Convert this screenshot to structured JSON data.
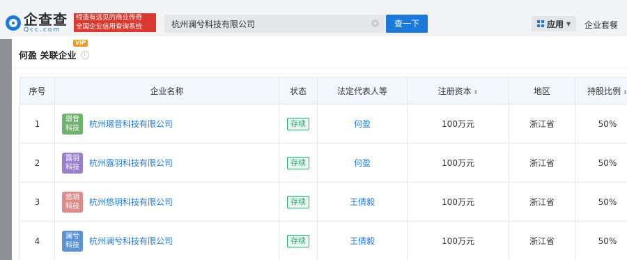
{
  "header": {
    "logo_name": "企查查",
    "logo_domain": "Qcc.com",
    "slogan_line1": "缔造有远见的商业传奇",
    "slogan_line2": "全国企业信用查询系统",
    "search_value": "杭州澜兮科技有限公司",
    "search_button": "查一下",
    "apps_label": "应用",
    "package_label": "企业套餐"
  },
  "modal": {
    "title": "何盈 关联企业",
    "vip_badge": "VIP"
  },
  "table": {
    "columns": [
      "序号",
      "企业名称",
      "状态",
      "法定代表人等",
      "注册资本",
      "地区",
      "持股比例"
    ],
    "sort_icon": "⬍",
    "rows": [
      {
        "no": "1",
        "avatar": [
          "璟昔",
          "科技"
        ],
        "avatar_color": "#6db36d",
        "name": "杭州璟昔科技有限公司",
        "status": "存续",
        "rep": "何盈",
        "capital": "100万元",
        "region": "浙江省",
        "share": "50%"
      },
      {
        "no": "2",
        "avatar": [
          "露羽",
          "科技"
        ],
        "avatar_color": "#9a7fd1",
        "name": "杭州露羽科技有限公司",
        "status": "存续",
        "rep": "何盈",
        "capital": "100万元",
        "region": "浙江省",
        "share": "50%"
      },
      {
        "no": "3",
        "avatar": [
          "悠玥",
          "科技"
        ],
        "avatar_color": "#e08a8a",
        "name": "杭州悠玥科技有限公司",
        "status": "存续",
        "rep": "王倩毅",
        "capital": "100万元",
        "region": "浙江省",
        "share": "50%"
      },
      {
        "no": "4",
        "avatar": [
          "澜兮",
          "科技"
        ],
        "avatar_color": "#5b93d6",
        "name": "杭州澜兮科技有限公司",
        "status": "存续",
        "rep": "王倩毅",
        "capital": "100万元",
        "region": "浙江省",
        "share": "50%"
      }
    ]
  },
  "icons": {
    "logo": "qcc-logo-icon",
    "clear": "clear-icon",
    "apps": "apps-grid-icon",
    "caret": "caret-down-icon",
    "info": "info-icon",
    "sort": "sort-icon"
  }
}
